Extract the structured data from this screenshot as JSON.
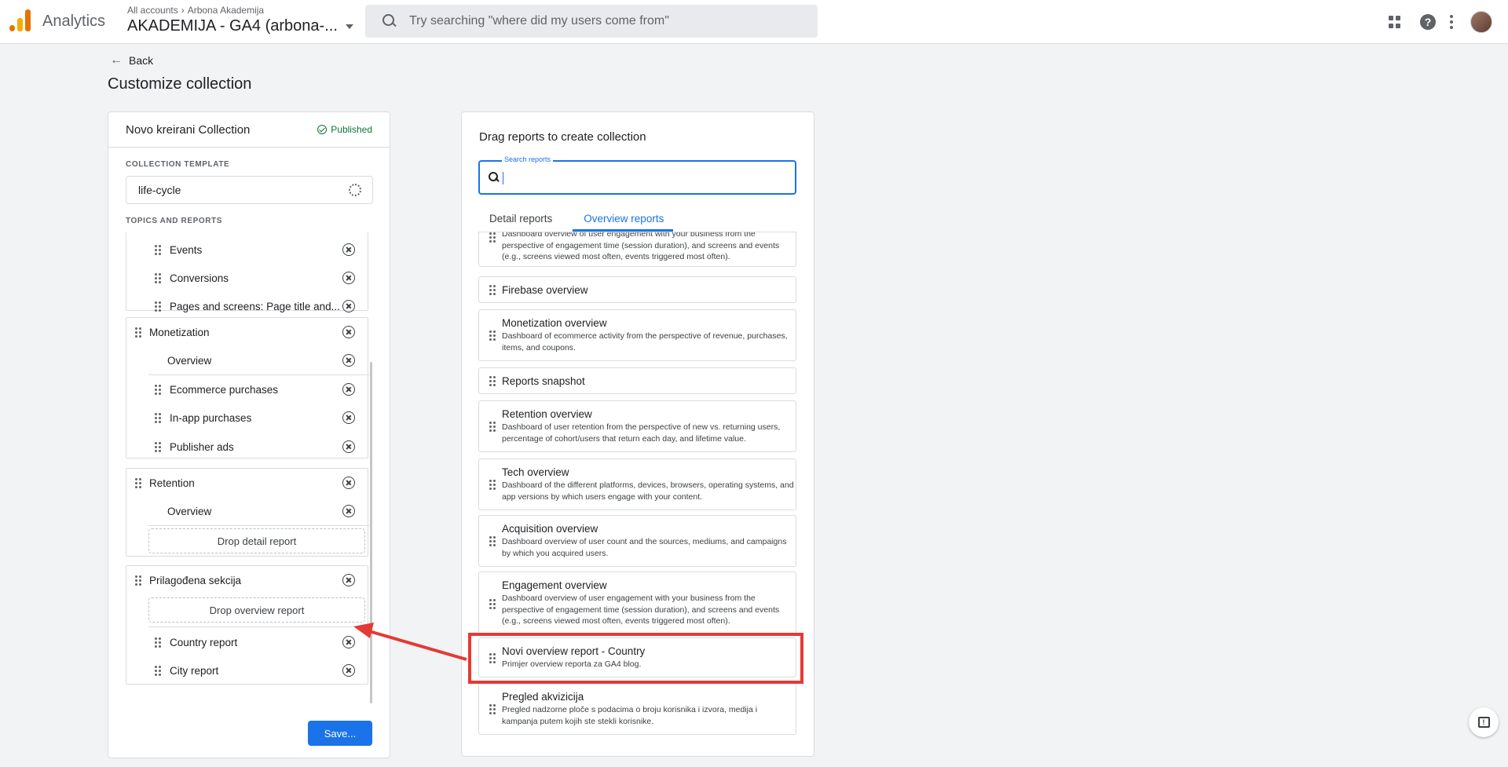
{
  "app": {
    "product_name": "Analytics",
    "breadcrumb": [
      "All accounts",
      "Arbona Akademija"
    ],
    "property_name": "AKADEMIJA - GA4 (arbona-...",
    "search_placeholder": "Try searching \"where did my users come from\"",
    "icons": [
      "apps-icon",
      "help-icon",
      "more-vert-icon",
      "avatar"
    ]
  },
  "page": {
    "back_label": "Back",
    "title": "Customize collection"
  },
  "collection": {
    "name": "Novo kreirani Collection",
    "status": "Published",
    "template_label": "COLLECTION TEMPLATE",
    "template_value": "life-cycle",
    "topics_label": "TOPICS AND REPORTS",
    "save_label": "Save...",
    "first_card_items": [
      "Events",
      "Conversions",
      "Pages and screens: Page title and..."
    ],
    "monetization": {
      "name": "Monetization",
      "overview": "Overview",
      "items": [
        "Ecommerce purchases",
        "In-app purchases",
        "Publisher ads"
      ]
    },
    "retention": {
      "name": "Retention",
      "overview": "Overview",
      "drop_label": "Drop detail report"
    },
    "custom": {
      "name": "Prilagođena sekcija",
      "drop_label": "Drop overview report",
      "items": [
        "Country report",
        "City report"
      ]
    }
  },
  "library": {
    "title": "Drag reports to create collection",
    "search_label": "Search reports",
    "tabs": [
      "Detail reports",
      "Overview reports"
    ],
    "active_tab": "Overview reports",
    "reports": [
      {
        "name": "",
        "desc": "Dashboard overview of user engagement with your business from the perspective of engagement time (session duration), and screens and events (e.g., screens viewed most often, events triggered most often)."
      },
      {
        "name": "Firebase overview",
        "desc": ""
      },
      {
        "name": "Monetization overview",
        "desc": "Dashboard of ecommerce activity from the perspective of revenue, purchases, items, and coupons."
      },
      {
        "name": "Reports snapshot",
        "desc": ""
      },
      {
        "name": "Retention overview",
        "desc": "Dashboard of user retention from the perspective of new vs. returning users, percentage of cohort/users that return each day, and lifetime value."
      },
      {
        "name": "Tech overview",
        "desc": "Dashboard of the different platforms, devices, browsers, operating systems, and app versions by which users engage with your content."
      },
      {
        "name": "Acquisition overview",
        "desc": "Dashboard overview of user count and the sources, mediums, and campaigns by which you acquired users."
      },
      {
        "name": "Engagement overview",
        "desc": "Dashboard overview of user engagement with your business from the perspective of engagement time (session duration), and screens and events (e.g., screens viewed most often, events triggered most often)."
      },
      {
        "name": "Novi overview report - Country",
        "desc": "Primjer overview reporta za GA4 blog."
      },
      {
        "name": "Pregled akvizicija",
        "desc": "Pregled nadzorne ploče s podacima o broju korisnika i izvora, medija i kampanja putem kojih ste stekli korisnike."
      }
    ]
  },
  "colors": {
    "accent": "#1a73e8",
    "published": "#137333",
    "annotation": "#e53935"
  }
}
